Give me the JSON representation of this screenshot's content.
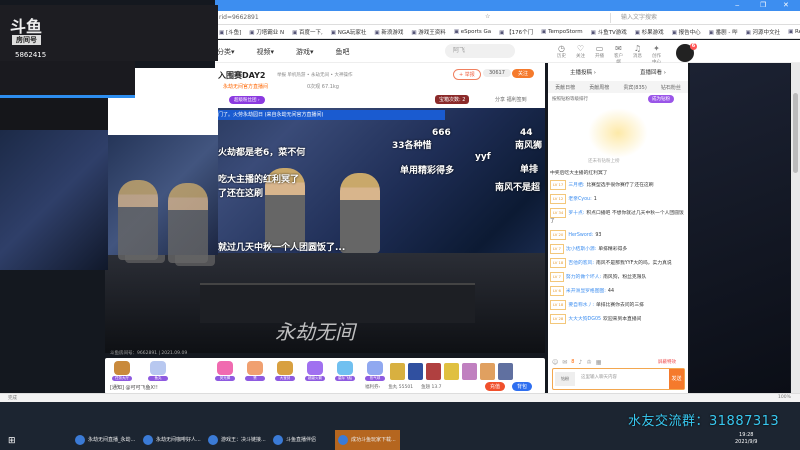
{
  "browser": {
    "url": "rid=9662891",
    "search_placeholder": "输入文字搜索",
    "bookmarks": [
      "[斗鱼]",
      "刀塔霸业 N",
      "百度一下,",
      "NGA玩家社",
      "新浪游戏",
      "游戏王资料",
      "eSports Ga",
      "【176个门",
      "TempoStorm",
      "斗鱼TV游戏",
      "杉果游戏",
      "报告中心",
      "番剧 - 哔",
      "河源中文社",
      "Re"
    ]
  },
  "overlay": {
    "logo": "斗鱼",
    "room_label": "房间号",
    "room_id": "5862415"
  },
  "nav": {
    "links": [
      "分类▾",
      "视频▾",
      "游戏▾",
      "鱼吧"
    ],
    "search_placeholder": "阿飞",
    "icons": [
      {
        "icon": "history-icon",
        "label": "历史"
      },
      {
        "icon": "heart-icon",
        "label": "关注"
      },
      {
        "icon": "video-icon",
        "label": "开播"
      },
      {
        "icon": "message-icon",
        "label": "客户端"
      },
      {
        "icon": "bell-icon",
        "label": "消息"
      },
      {
        "icon": "bulb-icon",
        "label": "创作中心"
      }
    ],
    "avatar_badge": "6"
  },
  "room": {
    "title": "入围赛DAY2",
    "sub": "举报   单机热游 • 永劫无间 • 大神操作",
    "tag": "永劫无间官方直播间",
    "stats": "0次观   67.1kg",
    "badge": "超级粉丝团 ›",
    "report": "+ 举报",
    "follow_count": "30617",
    "follow": "关注",
    "treasure": "宝箱次数: 2",
    "share": "分享   福利签到"
  },
  "video": {
    "banner": "门了。火劳永劫园日 (来自永劫无间官方直播间)",
    "footer": "斗鱼房间号：9662891 | 2021.09.09",
    "watermark": "永劫无间",
    "danmu": [
      "33各种惜",
      "南风狮",
      "666",
      "44",
      "火劫都是老6，菜不何",
      "yyf",
      "单用精彩得多",
      "单排",
      "吃大主播的红利冥了",
      "南风不是超",
      "了还在这刷",
      "就过几天中秋一个人团圆饭了...",
      "红利冥",
      "一个人团圆饭了..."
    ]
  },
  "gifts": {
    "items": [
      "任务大厅",
      "鱼丸",
      "荧光棒",
      "赞",
      "大宝剑",
      "超级火箭",
      "星际飞船",
      "热气球"
    ],
    "notice": "[通知] @可可飞鱼X!!",
    "stats": [
      "福利券›",
      "鱼丸 55501",
      "鱼翅 13.7"
    ],
    "charge": "充值",
    "bag": "背包"
  },
  "chat": {
    "top": [
      "主播投稿 ›",
      "直播回看 ›"
    ],
    "tabs": [
      "贡献日榜",
      "贡献周榜",
      "贵宾(835)",
      "钻石粉丝"
    ],
    "rank_hint": "按照钻粉等级排行",
    "fan_button": "成为钻粉",
    "mascot_caption": "还未有钻粉上榜",
    "system": "中奖后吃大主播的红利冥了",
    "messages": [
      {
        "lv": "LV 17",
        "nick": "三月栖:",
        "text": "比赛型选手很你赛疗了还在这刷"
      },
      {
        "lv": "LV 12",
        "nick": "老亲Cyou:",
        "text": "1"
      },
      {
        "lv": "LV 34",
        "nick": "罗十点:",
        "text": "积点口播吧 不想你就过几天中秋一个人团圆饭了"
      },
      {
        "lv": "LV 20",
        "nick": "HerSword:",
        "text": "93"
      },
      {
        "lv": "LV 7",
        "nick": "沈小桔斯小源:",
        "text": "单排精彩得多"
      },
      {
        "lv": "LV 18",
        "nick": "吉他的客风:",
        "text": "南风不是那我YYF大的吗，实力真说"
      },
      {
        "lv": "LV 7",
        "nick": "努力的做个坏人:",
        "text": "南风狗，粉丝克限队"
      },
      {
        "lv": "LV 6",
        "nick": "米开洲显罗格图图:",
        "text": "44"
      },
      {
        "lv": "LV 18",
        "nick": "要自称水丿:",
        "text": "单排比赛你去问的三排"
      },
      {
        "lv": "LV 28",
        "nick": "大大大狗DG05",
        "text": "欢迎来到本直播间"
      }
    ],
    "block": "屏蔽特效",
    "input_placeholder": "这里输入聊天内容",
    "level_btn": "钻粉",
    "send": "发送",
    "badge_count": "8"
  },
  "taskbar": {
    "tasks": [
      "永劫无间直播_永劫...",
      "永劫无间咖啡好人...",
      "游戏王：决斗链接...",
      "斗鱼直播伴侣",
      "成功斗鱼玩家下载..."
    ],
    "time": "19:28",
    "date": "2021/9/9"
  },
  "status": {
    "left": "完成",
    "right": "100%"
  },
  "group_text": "水友交流群：31887313"
}
